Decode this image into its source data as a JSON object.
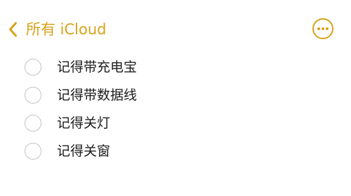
{
  "header": {
    "back_label": "所有 iCloud",
    "back_icon": "chevron-left-icon",
    "more_icon": "ellipsis-circle-icon"
  },
  "checklist": {
    "items": [
      {
        "label": "记得带充电宝",
        "checked": false
      },
      {
        "label": "记得带数据线",
        "checked": false
      },
      {
        "label": "记得关灯",
        "checked": false
      },
      {
        "label": "记得关窗",
        "checked": false
      }
    ]
  },
  "colors": {
    "accent": "#d9a21b",
    "text": "#1c1c1e",
    "checkbox_border": "#c3c3c7",
    "background": "#ffffff"
  }
}
